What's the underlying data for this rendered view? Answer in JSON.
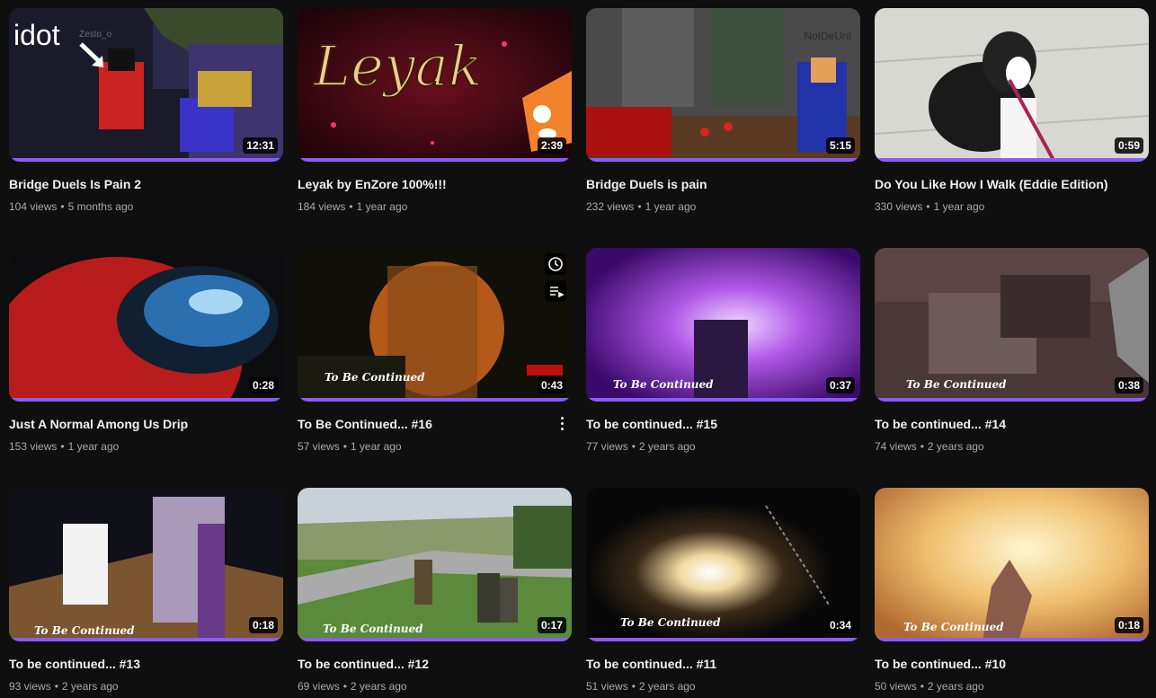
{
  "videos": [
    {
      "title": "Bridge Duels Is Pain 2",
      "views": "104 views",
      "age": "5 months ago",
      "duration": "12:31",
      "overlay_text": "idot",
      "watermark": "Zesto_o"
    },
    {
      "title": "Leyak by EnZore 100%!!!",
      "views": "184 views",
      "age": "1 year ago",
      "duration": "2:39",
      "overlay_text": "Leyak"
    },
    {
      "title": "Bridge Duels is pain",
      "views": "232 views",
      "age": "1 year ago",
      "duration": "5:15",
      "watermark": "NotDeUnt"
    },
    {
      "title": "Do You Like How I Walk (Eddie Edition)",
      "views": "330 views",
      "age": "1 year ago",
      "duration": "0:59"
    },
    {
      "title": "Just A Normal Among Us Drip",
      "views": "153 views",
      "age": "1 year ago",
      "duration": "0:28"
    },
    {
      "title": "To Be Continued... #16",
      "views": "57 views",
      "age": "1 year ago",
      "duration": "0:43",
      "overlay_text": "To Be Continued"
    },
    {
      "title": "To be continued... #15",
      "views": "77 views",
      "age": "2 years ago",
      "duration": "0:37",
      "overlay_text": "To Be Continued"
    },
    {
      "title": "To be continued... #14",
      "views": "74 views",
      "age": "2 years ago",
      "duration": "0:38",
      "overlay_text": "To Be Continued"
    },
    {
      "title": "To be continued... #13",
      "views": "93 views",
      "age": "2 years ago",
      "duration": "0:18",
      "overlay_text": "To Be Continued"
    },
    {
      "title": "To be continued... #12",
      "views": "69 views",
      "age": "2 years ago",
      "duration": "0:17",
      "overlay_text": "To Be Continued"
    },
    {
      "title": "To be continued... #11",
      "views": "51 views",
      "age": "2 years ago",
      "duration": "0:34",
      "overlay_text": "To Be Continued"
    },
    {
      "title": "To be continued... #10",
      "views": "50 views",
      "age": "2 years ago",
      "duration": "0:18",
      "overlay_text": "To Be Continued"
    }
  ],
  "dot": "•",
  "colors": {
    "progress": "#8c5cf6",
    "background": "#0f0f0f",
    "meta_text": "#aaaaaa"
  }
}
